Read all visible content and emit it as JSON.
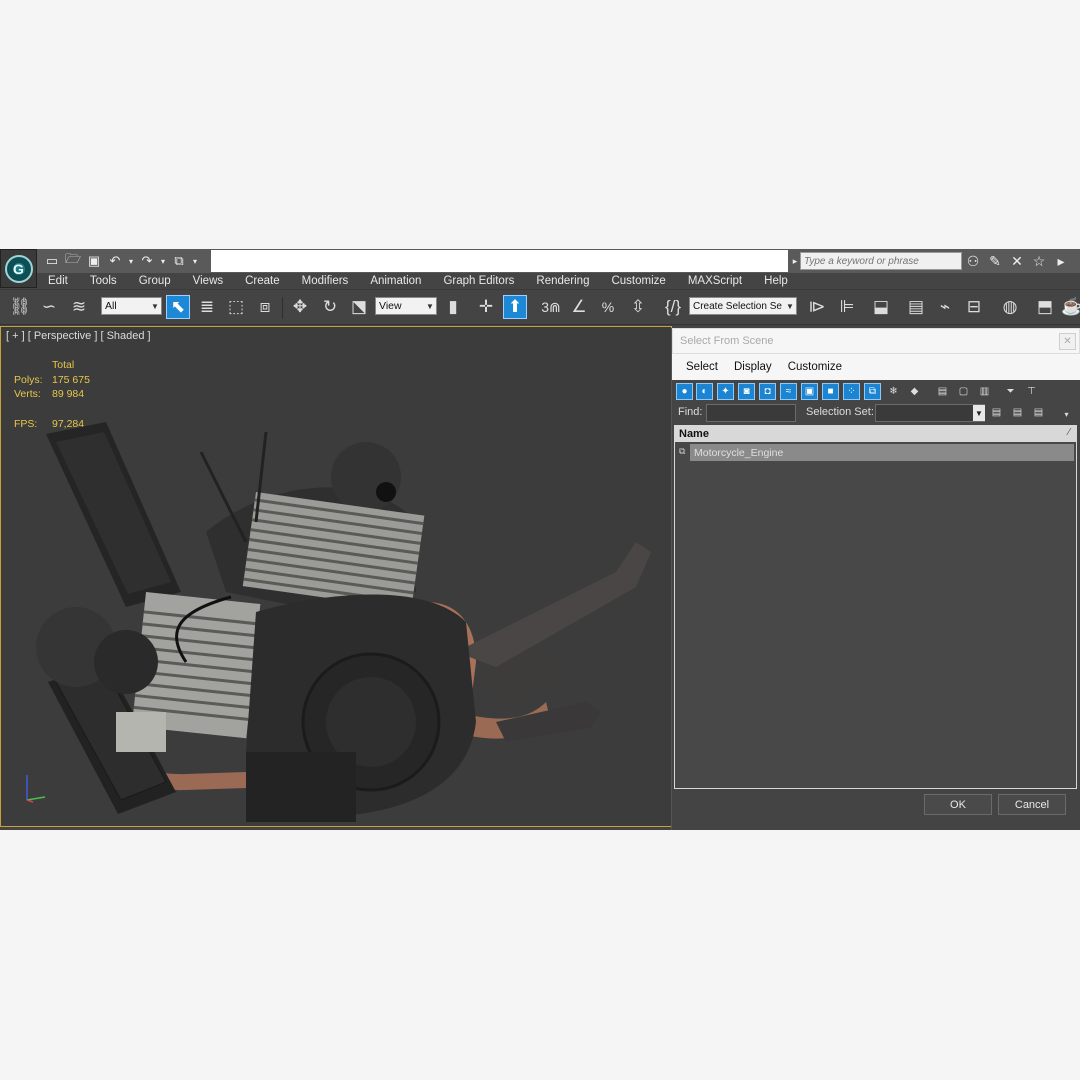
{
  "toolbar_quick": {
    "search": {
      "placeholder": "Type a keyword or phrase"
    }
  },
  "menu": [
    "Edit",
    "Tools",
    "Group",
    "Views",
    "Create",
    "Modifiers",
    "Animation",
    "Graph Editors",
    "Rendering",
    "Customize",
    "MAXScript",
    "Help"
  ],
  "main_toolbar": {
    "selection_filter": "All",
    "reference_coord": "View",
    "snap_angle_label": "3",
    "create_selection_set": "Create Selection Se"
  },
  "viewport": {
    "label": "[ + ] [ Perspective ] [ Shaded ]",
    "stats": {
      "total_label": "Total",
      "polys_label": "Polys:",
      "polys_value": "175 675",
      "verts_label": "Verts:",
      "verts_value": "89 984",
      "fps_label": "FPS:",
      "fps_value": "97,284"
    }
  },
  "dialog": {
    "title": "Select From Scene",
    "menu": [
      "Select",
      "Display",
      "Customize"
    ],
    "find_label": "Find:",
    "selection_set_label": "Selection Set:",
    "list_header": "Name",
    "items": [
      {
        "name": "Motorcycle_Engine"
      }
    ],
    "ok_label": "OK",
    "cancel_label": "Cancel"
  },
  "colors": {
    "active_blue": "#1d88d6",
    "viewport_border": "#c7a23a",
    "stats_text": "#e6c84a"
  }
}
